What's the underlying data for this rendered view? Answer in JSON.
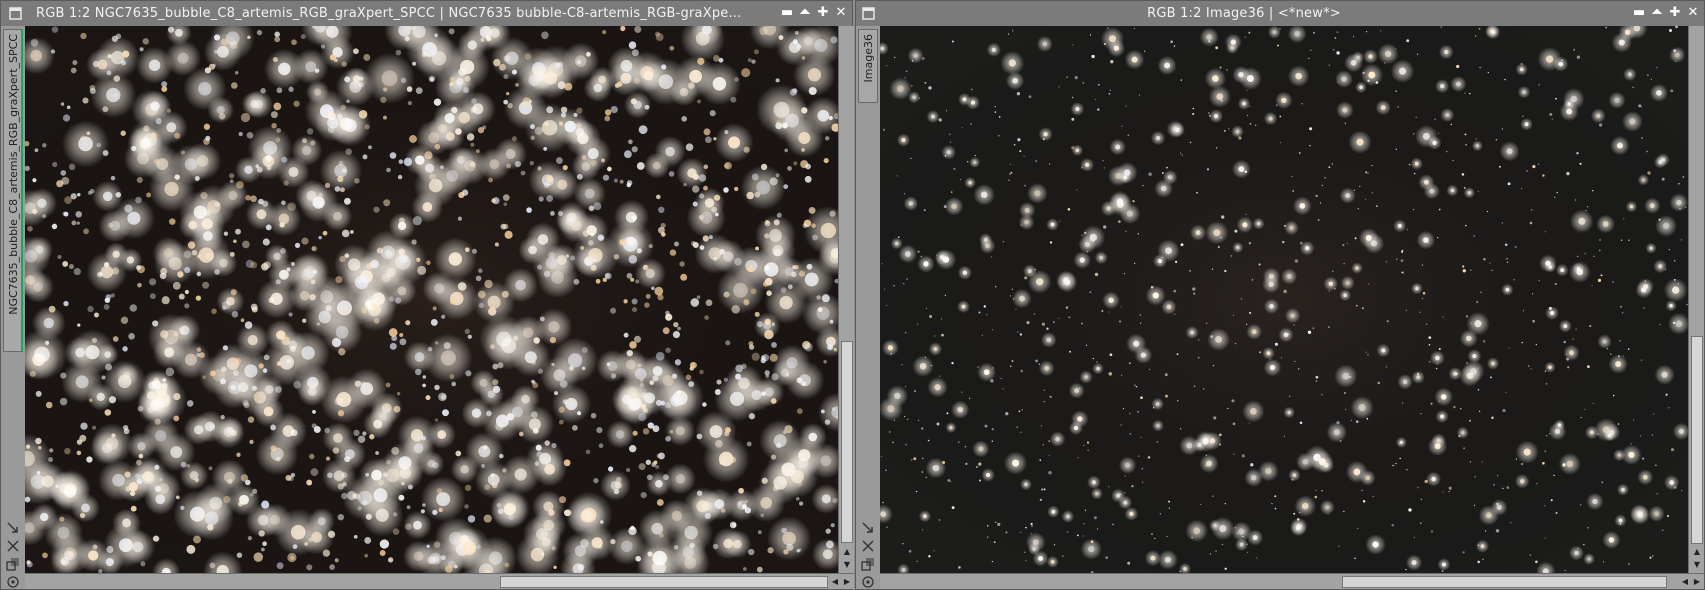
{
  "left_window": {
    "title": "RGB 1:2 NGC7635_bubble_C8_artemis_RGB_graXpert_SPCC | NGC7635 bubble-C8-artemis_RGB-graXpe...",
    "side_tab": "NGC7635_bubble_C8_artemis_RGB_graXpert_SPCC",
    "buttons": {
      "shade": "▬",
      "minimize": "⏶",
      "maximize": "✚",
      "close": "✕"
    }
  },
  "right_window": {
    "title": "RGB 1:2 Image36 | <*new*>",
    "side_tab": "Image36",
    "buttons": {
      "shade": "▬",
      "minimize": "⏶",
      "maximize": "✚",
      "close": "✕"
    }
  },
  "scroll_arrows": {
    "up": "▲",
    "down": "▼",
    "left": "◀",
    "right": "▶"
  },
  "colors": {
    "titlebar": "#7b7b7b",
    "left_image_background": "#1b1614",
    "right_image_background": "#1c1c1b",
    "active_tab_accent": "#17a85a"
  }
}
